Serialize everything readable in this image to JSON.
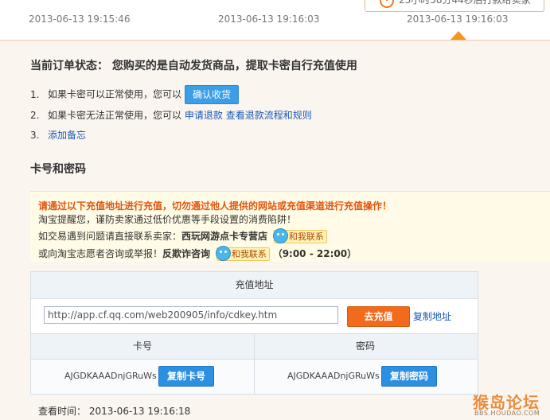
{
  "timeline": {
    "times": [
      "2013-06-13 19:15:46",
      "2013-06-13 19:16:03",
      "2013-06-13 19:16:03"
    ],
    "countdown": "23小时58分44秒后打款给卖家"
  },
  "order": {
    "status": "当前订单状态：  您购买的是自动发货商品，提取卡密自行充值使用",
    "step1": {
      "num": "1.",
      "text": "如果卡密可以正常使用，您可以",
      "button": "确认收货"
    },
    "step2": {
      "num": "2.",
      "text": "如果卡密无法正常使用，您可以",
      "link1": "申请退款",
      "link2": "查看退款流程和规则"
    },
    "step3": {
      "num": "3.",
      "link": "添加备忘"
    }
  },
  "card_section": {
    "title": "卡号和密码",
    "notice": {
      "warning": "请通过以下充值地址进行充值，切勿通过他人提供的网站或充值渠道进行充值操作！",
      "tip": "淘宝提醒您，谨防卖家通过低价优惠等手段设置的消费陷阱！",
      "seller_prefix": "如交易遇到问题请直接联系卖家：",
      "seller_name": "西玩网游点卡专营店",
      "contact_label": "和我联系",
      "report_prefix": "或向淘宝志愿者咨询或举报！",
      "report_name": "反欺诈咨询",
      "contact_label2": "和我联系",
      "hours": "（9:00 - 22:00）"
    },
    "table": {
      "url_header": "充值地址",
      "url_value": "http://app.cf.qq.com/web200905/info/cdkey.htm",
      "recharge_button": "去充值",
      "copy_url": "复制地址",
      "card_label": "卡号",
      "password_label": "密码",
      "card_value": "AJGDKAAADnjGRuWs",
      "password_value": "AJGDKAAADnjGRuWs",
      "copy_card": "复制卡号",
      "copy_password": "复制密码"
    },
    "view_time": "查看时间：  2013-06-13 19:16:18"
  },
  "watermark": {
    "main": "猴岛论坛",
    "sub": "BBS.HOUDAO.COM"
  },
  "colors": {
    "accent": "#f7941d",
    "link": "#1a59b7",
    "warning": "#e0560f",
    "button_blue": "#2d8fe0",
    "button_orange": "#f26b1d"
  }
}
